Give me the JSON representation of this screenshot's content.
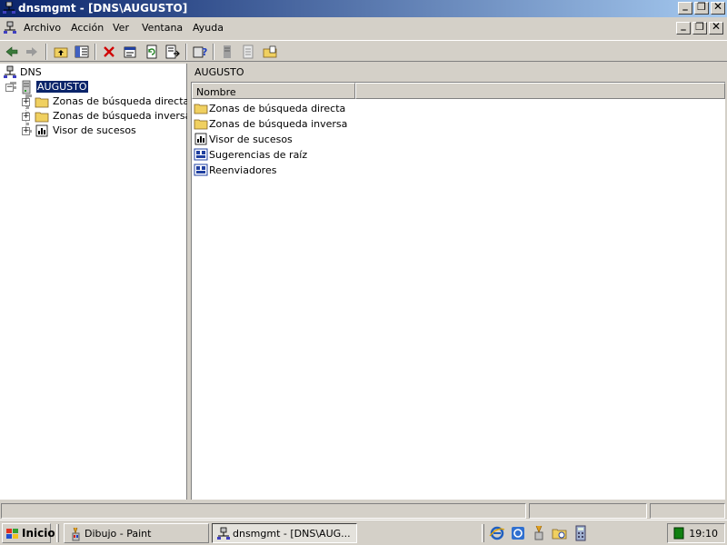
{
  "window": {
    "title": "dnsmgmt - [DNS\\AUGUSTO]",
    "minimize_glyph": "_",
    "restore_glyph": "❐",
    "close_glyph": "✕"
  },
  "menu": {
    "items": [
      "Archivo",
      "Acción",
      "Ver",
      "Ventana",
      "Ayuda"
    ]
  },
  "toolbar": {
    "buttons": [
      "back-icon",
      "forward-icon",
      "up-folder-icon",
      "show-tree-icon",
      "delete-icon",
      "properties-icon",
      "refresh-icon",
      "export-list-icon",
      "help-icon",
      "server-icon",
      "notepad-icon",
      "new-zone-icon"
    ]
  },
  "tree": {
    "root": "DNS",
    "server": "AUGUSTO",
    "collapse_glyph": "−",
    "expand_glyph": "+",
    "children": [
      "Zonas de búsqueda directa",
      "Zonas de búsqueda inversa",
      "Visor de sucesos"
    ]
  },
  "right_pane": {
    "header": "AUGUSTO",
    "column": "Nombre",
    "items": [
      {
        "label": "Zonas de búsqueda directa",
        "icon": "folder-icon"
      },
      {
        "label": "Zonas de búsqueda inversa",
        "icon": "folder-icon"
      },
      {
        "label": "Visor de sucesos",
        "icon": "event-viewer-icon"
      },
      {
        "label": "Sugerencias de raíz",
        "icon": "root-hints-icon"
      },
      {
        "label": "Reenviadores",
        "icon": "forwarders-icon"
      }
    ]
  },
  "taskbar": {
    "start": "Inicio",
    "tasks": [
      "Dibujo - Paint",
      "dnsmgmt - [DNS\\AUG..."
    ],
    "clock": "19:10"
  },
  "colors": {
    "title_start": "#0a246a",
    "title_end": "#a6caf0",
    "selection": "#0a246a",
    "face": "#d4d0c8"
  }
}
